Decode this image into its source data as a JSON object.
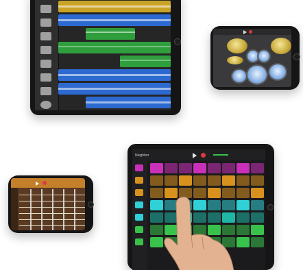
{
  "scene": {
    "description_devices": [
      "ipad-tracks",
      "iphone-drums",
      "iphone-guitar",
      "ipad-live-loops"
    ]
  },
  "ipad_live_loops": {
    "app_label": "Neighbor"
  },
  "colors": {
    "track_yellow": "#c9a326",
    "track_blue": "#2c6ad1",
    "track_green": "#2f9e3d",
    "loop_magenta": "#c92fb8",
    "loop_orange": "#d9911e",
    "loop_cyan": "#2fd0d6",
    "loop_teal": "#1fb6a6",
    "loop_green": "#39c24b"
  }
}
